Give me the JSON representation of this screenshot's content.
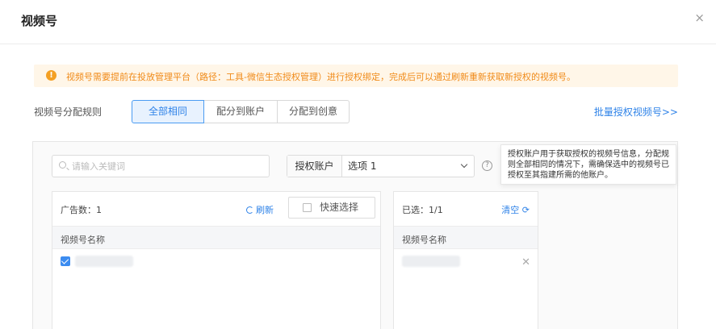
{
  "dialog": {
    "title": "视频号",
    "close_icon": "×"
  },
  "notice": {
    "icon": "!",
    "text": "视频号需要提前在投放管理平台（路径：工具-微信生态授权管理）进行授权绑定，完成后可以通过刷新重新获取新授权的视频号。",
    "color": "#f08a18"
  },
  "rules": {
    "label": "视频号分配规则",
    "options": [
      "全部相同",
      "配分到账户",
      "分配到创意"
    ],
    "selected_index": 0,
    "batch_link": "批量授权视频号>>"
  },
  "filter": {
    "search_placeholder": "请输入关键词",
    "auth_label": "授权账户",
    "auth_value": "选项 1",
    "help_icon": "?",
    "tooltip": "授权账户用于获取授权的视频号信息，分配规则全部相同的情况下，需确保选中的视频号已授权至其指建所需的他账户。"
  },
  "left_list": {
    "count": "广告数：1",
    "refresh": "刷新",
    "quick_select": "快速选择",
    "column": "视频号名称"
  },
  "right_list": {
    "selected": "已选：1/1",
    "clear": "清空 ⟳",
    "column": "视频号名称",
    "remove_icon": "✕"
  },
  "colors": {
    "accent": "#2f83e8",
    "notice_bg": "#fff6e8"
  }
}
